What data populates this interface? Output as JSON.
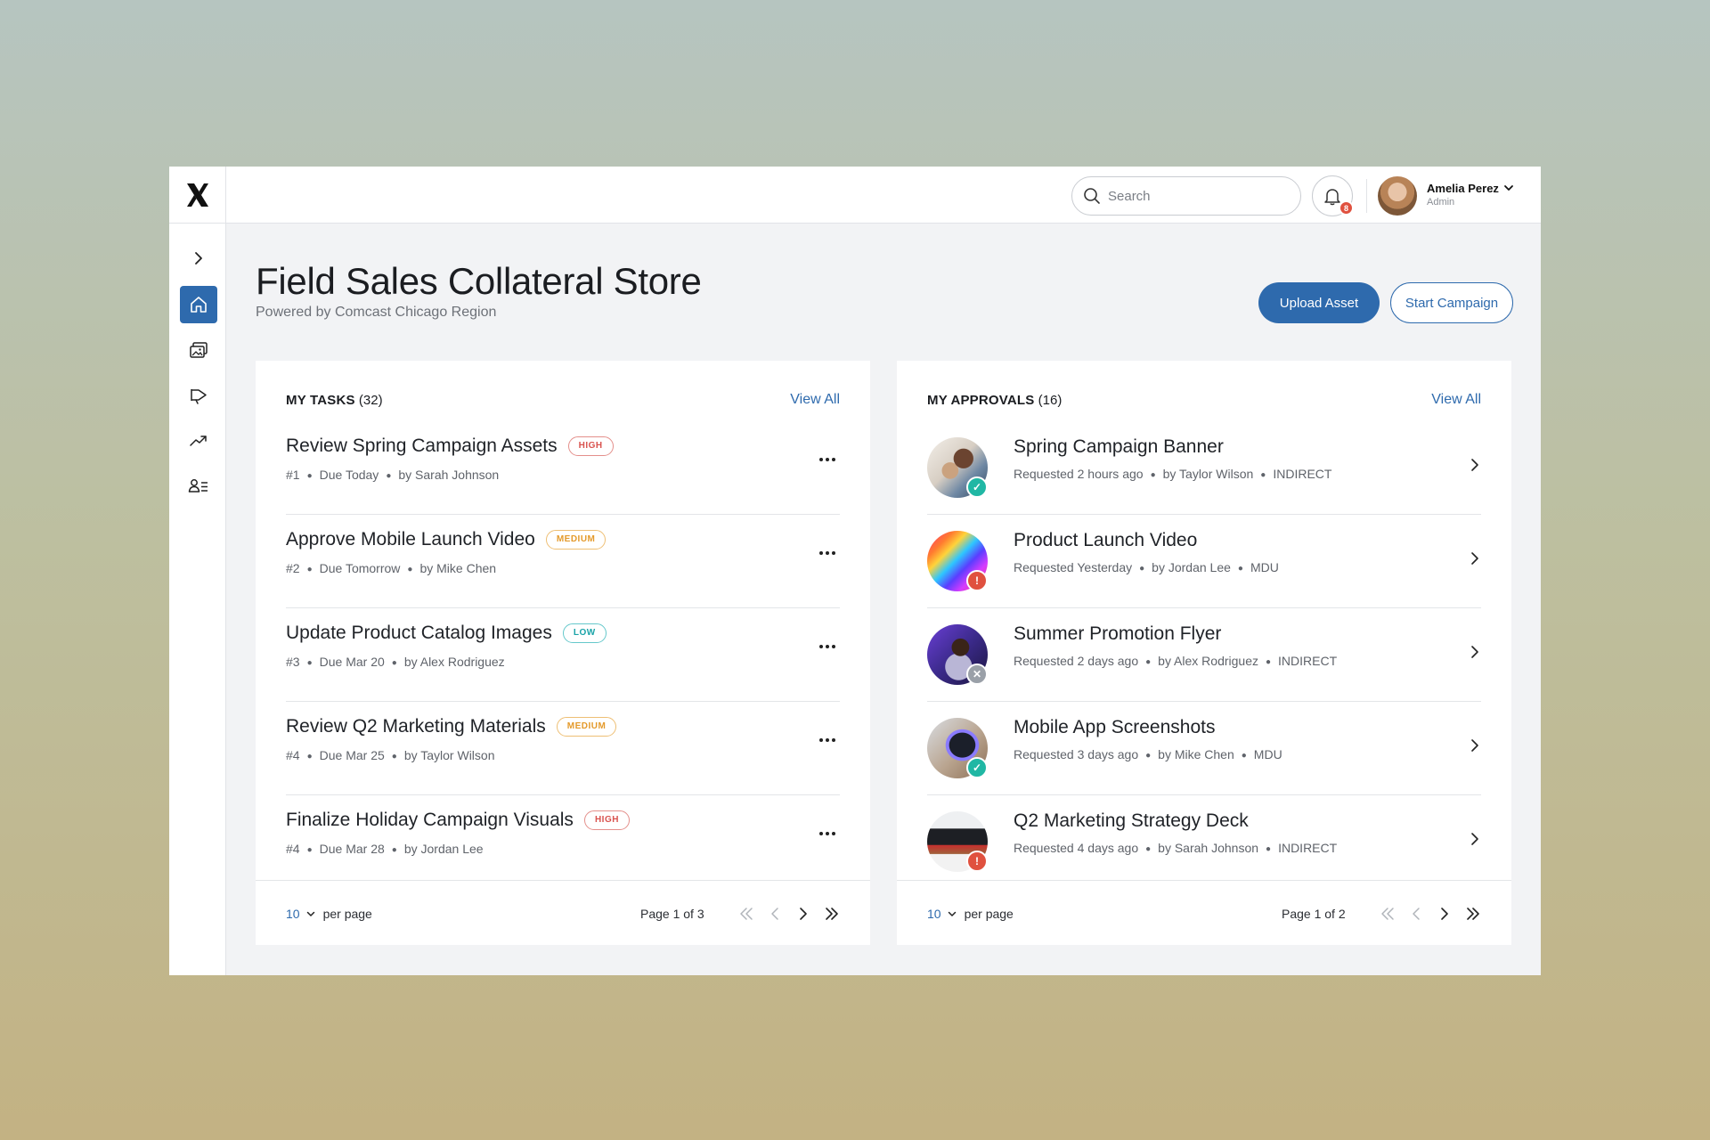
{
  "header": {
    "logo": "X",
    "search_placeholder": "Search",
    "notifications_count": "8",
    "user": {
      "name": "Amelia Perez",
      "role": "Admin"
    }
  },
  "sidebar": {
    "items": [
      {
        "name": "expand",
        "icon": "chevron-right-icon"
      },
      {
        "name": "home",
        "icon": "home-icon",
        "active": true
      },
      {
        "name": "assets",
        "icon": "images-icon"
      },
      {
        "name": "campaigns",
        "icon": "megaphone-icon"
      },
      {
        "name": "analytics",
        "icon": "trending-icon"
      },
      {
        "name": "users",
        "icon": "user-list-icon"
      }
    ]
  },
  "page": {
    "title": "Field Sales Collateral Store",
    "subtitle": "Powered by Comcast Chicago Region",
    "upload_label": "Upload Asset",
    "start_label": "Start Campaign"
  },
  "tasks": {
    "title": "MY TASKS",
    "count": "(32)",
    "view_all": "View All",
    "items": [
      {
        "title": "Review Spring Campaign Assets",
        "priority": "HIGH",
        "num": "#1",
        "due": "Due Today",
        "by": "by Sarah Johnson"
      },
      {
        "title": "Approve Mobile Launch Video",
        "priority": "MEDIUM",
        "num": "#2",
        "due": "Due Tomorrow",
        "by": "by Mike Chen"
      },
      {
        "title": "Update Product Catalog Images",
        "priority": "LOW",
        "num": "#3",
        "due": "Due Mar 20",
        "by": "by Alex Rodriguez"
      },
      {
        "title": "Review Q2 Marketing Materials",
        "priority": "MEDIUM",
        "num": "#4",
        "due": "Due Mar 25",
        "by": "by Taylor Wilson"
      },
      {
        "title": "Finalize Holiday Campaign Visuals",
        "priority": "HIGH",
        "num": "#4",
        "due": "Due Mar 28",
        "by": "by Jordan Lee"
      }
    ],
    "per_page": "10",
    "per_page_label": "per page",
    "page_info": "Page 1 of 3"
  },
  "approvals": {
    "title": "MY APPROVALS",
    "count": "(16)",
    "view_all": "View All",
    "items": [
      {
        "title": "Spring Campaign Banner",
        "requested": "Requested 2 hours ago",
        "by": "by Taylor Wilson",
        "type": "INDIRECT",
        "status": "approved"
      },
      {
        "title": "Product Launch Video",
        "requested": "Requested Yesterday",
        "by": "by Jordan Lee",
        "type": "MDU",
        "status": "warning"
      },
      {
        "title": "Summer Promotion Flyer",
        "requested": "Requested 2 days ago",
        "by": "by Alex Rodriguez",
        "type": "INDIRECT",
        "status": "rejected"
      },
      {
        "title": "Mobile App Screenshots",
        "requested": "Requested 3 days ago",
        "by": "by Mike Chen",
        "type": "MDU",
        "status": "approved"
      },
      {
        "title": "Q2 Marketing Strategy Deck",
        "requested": "Requested 4 days ago",
        "by": "by Sarah Johnson",
        "type": "INDIRECT",
        "status": "warning"
      }
    ],
    "per_page": "10",
    "per_page_label": "per page",
    "page_info": "Page 1 of 2"
  },
  "colors": {
    "primary": "#2e6aad",
    "high": "#d9534f",
    "medium": "#e49a2b",
    "low": "#1aa3a8",
    "status_ok": "#20b7a4",
    "status_warn": "#e0513f",
    "status_rejected": "#9aa0a8"
  }
}
